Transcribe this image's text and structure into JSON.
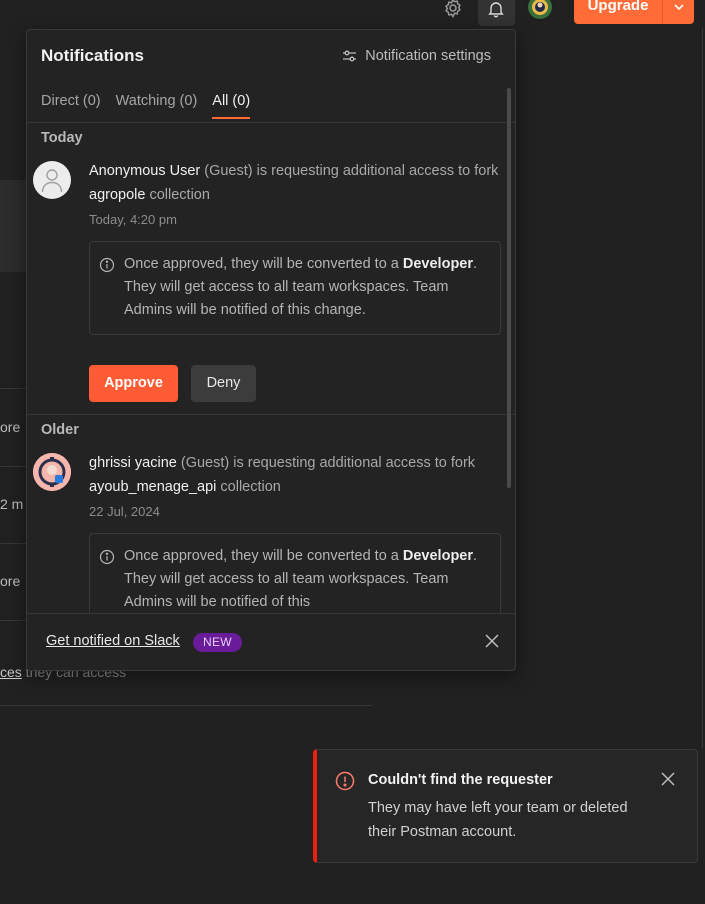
{
  "topbar": {
    "upgrade_label": "Upgrade",
    "icons": [
      "gear-icon",
      "bell-icon",
      "chevron-down-icon"
    ],
    "accent_color": "#ff6c37"
  },
  "background": {
    "fragments": [
      "ore",
      "2 m",
      "ore"
    ],
    "link_text": "ces",
    "trail_text": " they can access"
  },
  "panel": {
    "title": "Notifications",
    "settings_label": "Notification settings",
    "tabs": [
      {
        "label": "Direct (0)",
        "active": false
      },
      {
        "label": "Watching (0)",
        "active": false
      },
      {
        "label": "All (0)",
        "active": true
      }
    ],
    "sections": [
      {
        "heading": "Today",
        "item": {
          "user": "Anonymous User",
          "role": "(Guest)",
          "text": " is requesting additional access to fork ",
          "collection": "agropole",
          "suffix": " collection",
          "time": "Today, 4:20 pm",
          "info_pre": "Once approved, they will be converted to a ",
          "info_bold": "Developer",
          "info_post": ". They will get access to all team workspaces. Team Admins will be notified of this change.",
          "approve_label": "Approve",
          "deny_label": "Deny"
        }
      },
      {
        "heading": "Older",
        "item": {
          "user": "ghrissi yacine",
          "role": "(Guest)",
          "text": " is requesting additional access to fork ",
          "collection": "ayoub_menage_api",
          "suffix": " collection",
          "time": "22 Jul, 2024",
          "info_pre": "Once approved, they will be converted to a ",
          "info_bold": "Developer",
          "info_post": ". They will get access to all team workspaces. Team Admins will be notified of this"
        }
      }
    ],
    "footer": {
      "slack_label": "Get notified on Slack",
      "badge": "NEW"
    }
  },
  "toast": {
    "title": "Couldn't find the requester",
    "body": "They may have left your team or deleted their Postman account.",
    "status_color": "#eb2013"
  }
}
